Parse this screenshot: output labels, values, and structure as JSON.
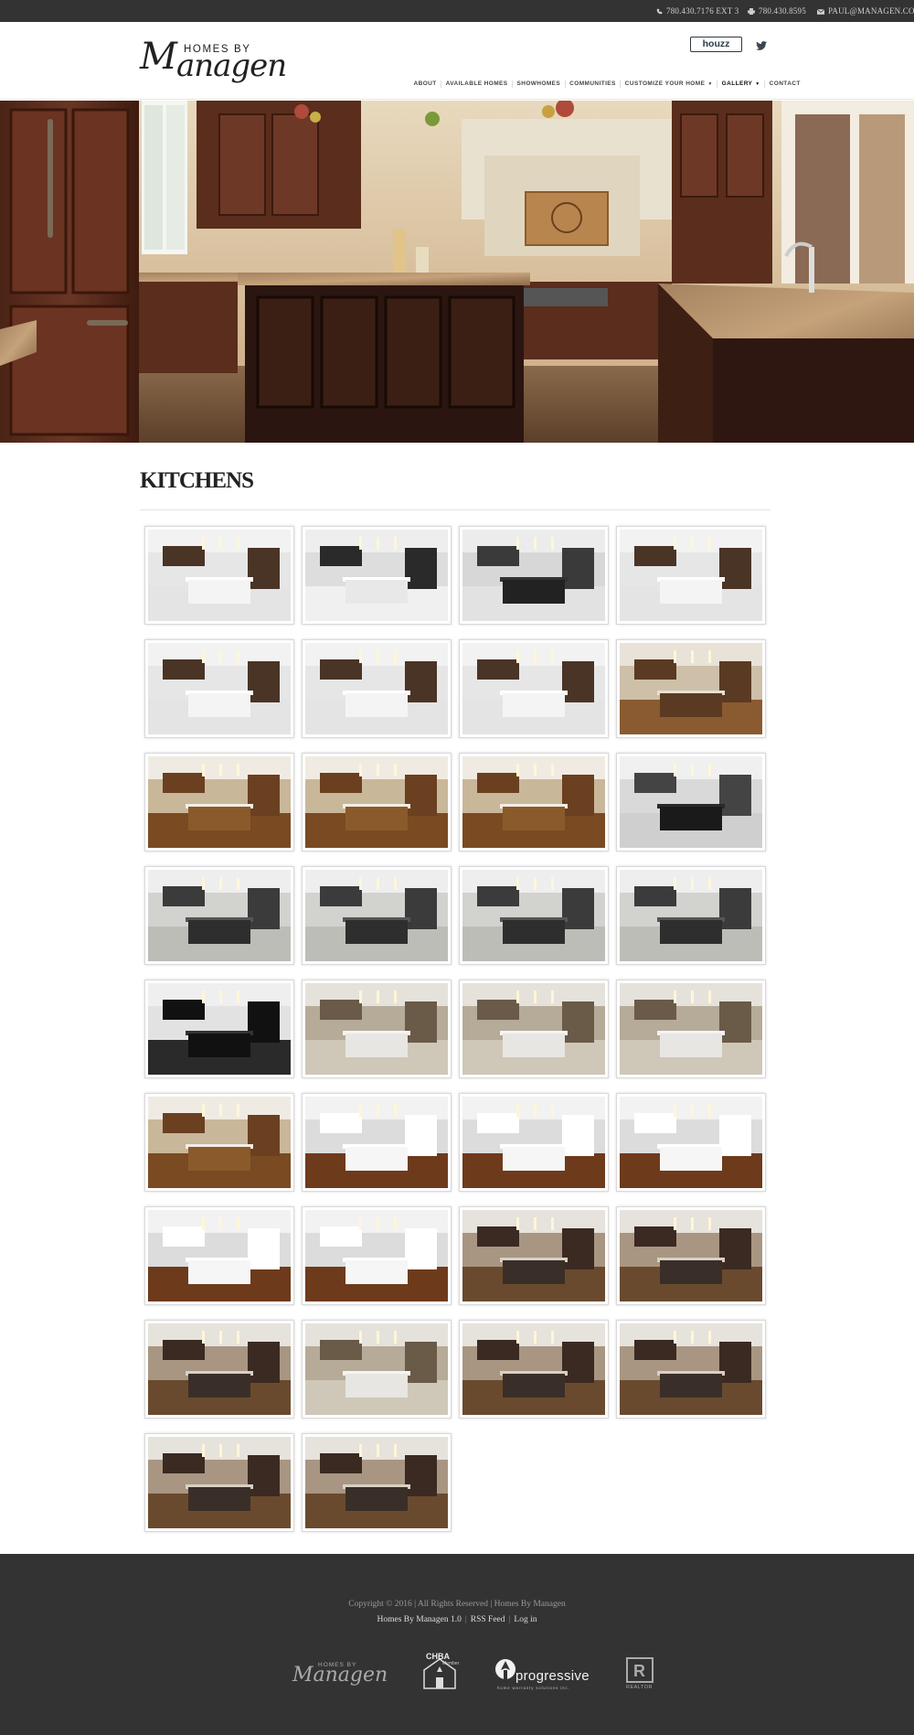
{
  "topbar": {
    "phone": "780.430.7176 EXT 3",
    "fax": "780.430.8595",
    "email": "PAUL@MANAGEN.COM"
  },
  "header": {
    "logo_small": "HOMES BY",
    "logo_script_cap": "M",
    "logo_script_rest": "anagen",
    "houzz": "houzz"
  },
  "nav": {
    "items": [
      "ABOUT",
      "AVAILABLE HOMES",
      "SHOWHOMES",
      "COMMUNITIES",
      "CUSTOMIZE YOUR HOME",
      "GALLERY",
      "CONTACT"
    ],
    "active": "GALLERY"
  },
  "page": {
    "title": "KITCHENS"
  },
  "footer": {
    "copyright": "Copyright © 2016 | All Rights Reserved | Homes By Managen",
    "link1": "Homes By Managen 1.0",
    "link2": "RSS Feed",
    "link3": "Log in",
    "logo1_small": "HOMES BY",
    "logo1_script": "Managen",
    "logo2_title": "CHBA",
    "logo2_sub": "Member",
    "logo3_title": "progressive",
    "logo3_sub": "home warranty solutions inc.",
    "logo4_title": "REALTOR"
  },
  "colors": {
    "topbar": "#333333",
    "footer": "#333333",
    "accent_wood": "#5a2e1c"
  },
  "gallery": {
    "thumbs": [
      {
        "scheme": "white"
      },
      {
        "scheme": "white-stair"
      },
      {
        "scheme": "white-dining"
      },
      {
        "scheme": "white"
      },
      {
        "scheme": "white"
      },
      {
        "scheme": "white"
      },
      {
        "scheme": "white"
      },
      {
        "scheme": "wood-dining"
      },
      {
        "scheme": "wood"
      },
      {
        "scheme": "wood"
      },
      {
        "scheme": "wood"
      },
      {
        "scheme": "white-round"
      },
      {
        "scheme": "modern"
      },
      {
        "scheme": "modern"
      },
      {
        "scheme": "modern"
      },
      {
        "scheme": "modern"
      },
      {
        "scheme": "dining-dark"
      },
      {
        "scheme": "grey"
      },
      {
        "scheme": "grey"
      },
      {
        "scheme": "grey"
      },
      {
        "scheme": "wood"
      },
      {
        "scheme": "white-wood"
      },
      {
        "scheme": "white-wood"
      },
      {
        "scheme": "white-wood"
      },
      {
        "scheme": "white-wood"
      },
      {
        "scheme": "white-wood"
      },
      {
        "scheme": "dark"
      },
      {
        "scheme": "dark"
      },
      {
        "scheme": "dark"
      },
      {
        "scheme": "grey"
      },
      {
        "scheme": "dark"
      },
      {
        "scheme": "dark"
      },
      {
        "scheme": "dark"
      },
      {
        "scheme": "dark"
      }
    ]
  }
}
